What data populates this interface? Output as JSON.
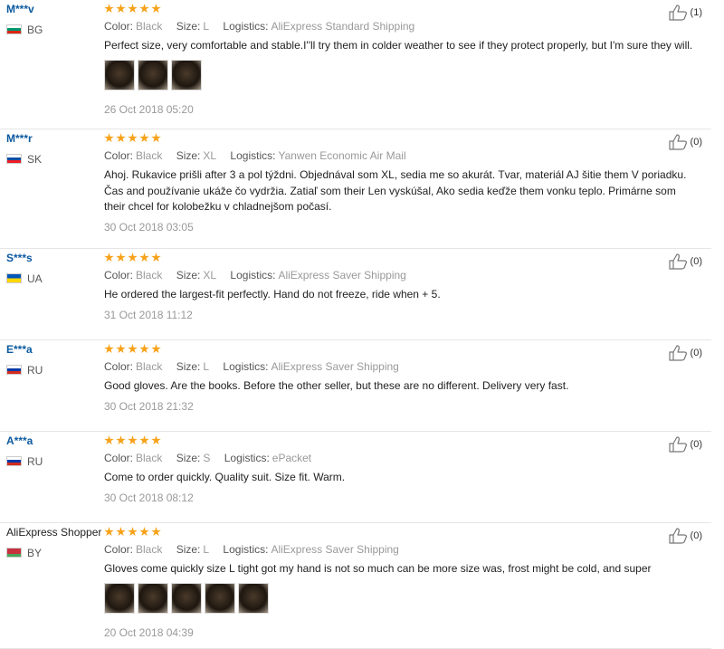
{
  "labels": {
    "color": "Color:",
    "size": "Size:",
    "logistics": "Logistics:"
  },
  "colors": {
    "stars": "#f7a21a",
    "user_link": "#0c5aa0",
    "divider": "#e6e6e6"
  },
  "reviews": [
    {
      "user": "M***v",
      "country": "BG",
      "flag": "flag-bulgaria",
      "stars": 5,
      "color": "Black",
      "size": "L",
      "logistics": "AliExpress Standard Shipping",
      "text": "Perfect size, very comfortable and stable.I''ll try them in colder weather to see if they protect properly, but I'm sure they will.",
      "photos": 3,
      "date": "26 Oct 2018 05:20",
      "likes": "(1)"
    },
    {
      "user": "M***r",
      "country": "SK",
      "flag": "flag-slovakia",
      "stars": 5,
      "color": "Black",
      "size": "XL",
      "logistics": "Yanwen Economic Air Mail",
      "text": "Ahoj. Rukavice prišli after 3 a pol týždni. Objednával som XL, sedia me so akurát. Tvar, materiál AJ šitie them V poriadku. Čas and používanie ukáže čo vydržia. Zatiaľ som their Len vyskúšal, Ako sedia keďže them vonku teplo. Primárne som their chcel for kolobežku v chladnejšom počasí.",
      "photos": 0,
      "date": "30 Oct 2018 03:05",
      "likes": "(0)"
    },
    {
      "user": "S***s",
      "country": "UA",
      "flag": "flag-ukraine",
      "stars": 5,
      "color": "Black",
      "size": "XL",
      "logistics": "AliExpress Saver Shipping",
      "text": "He ordered the largest-fit perfectly. Hand do not freeze, ride when + 5.",
      "photos": 0,
      "date": "31 Oct 2018 11:12",
      "likes": "(0)"
    },
    {
      "user": "E***a",
      "country": "RU",
      "flag": "flag-russia",
      "stars": 5,
      "color": "Black",
      "size": "L",
      "logistics": "AliExpress Saver Shipping",
      "text": "Good gloves. Are the books. Before the other seller, but these are no different. Delivery very fast.",
      "photos": 0,
      "date": "30 Oct 2018 21:32",
      "likes": "(0)"
    },
    {
      "user": "A***a",
      "country": "RU",
      "flag": "flag-russia",
      "stars": 5,
      "color": "Black",
      "size": "S",
      "logistics": "ePacket",
      "text": "Come to order quickly. Quality suit. Size fit. Warm.",
      "photos": 0,
      "date": "30 Oct 2018 08:12",
      "likes": "(0)"
    },
    {
      "user": "AliExpress Shopper",
      "country": "BY",
      "flag": "flag-belarus",
      "stars": 5,
      "color": "Black",
      "size": "L",
      "logistics": "AliExpress Saver Shipping",
      "text": "Gloves come quickly size L tight got my hand is not so much can be more size was, frost might be cold, and super",
      "photos": 5,
      "date": "20 Oct 2018 04:39",
      "likes": "(0)"
    }
  ]
}
